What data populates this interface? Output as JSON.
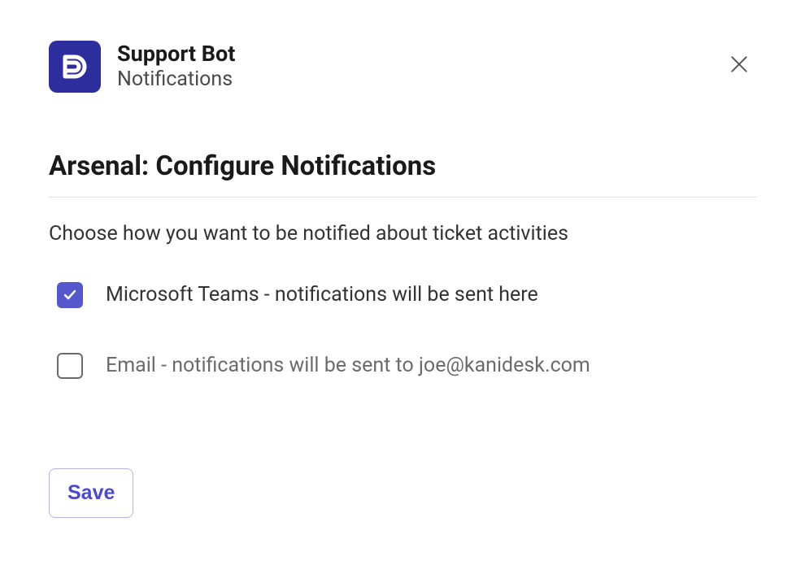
{
  "header": {
    "app_title": "Support Bot",
    "app_subtitle": "Notifications"
  },
  "section": {
    "title": "Arsenal: Configure Notifications",
    "description": "Choose how you want to be notified about ticket activities"
  },
  "options": [
    {
      "label": "Microsoft Teams - notifications will be sent here",
      "checked": true
    },
    {
      "label": "Email - notifications will be sent to joe@kanidesk.com",
      "checked": false
    }
  ],
  "actions": {
    "save_label": "Save"
  },
  "colors": {
    "accent": "#5558cc",
    "brand": "#2e2d9e"
  }
}
